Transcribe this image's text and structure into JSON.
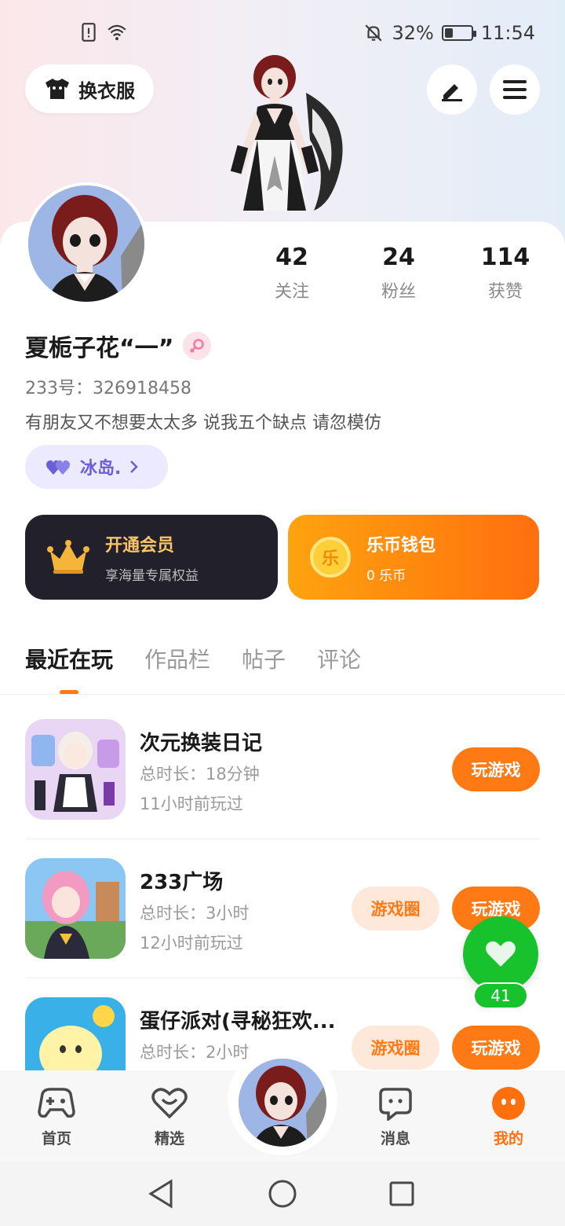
{
  "status_bar": {
    "battery": "32%",
    "time": "11:54",
    "battery_level": 0.32
  },
  "header": {
    "outfit_label": "换衣服"
  },
  "profile": {
    "stats": [
      {
        "value": "42",
        "label": "关注"
      },
      {
        "value": "24",
        "label": "粉丝"
      },
      {
        "value": "114",
        "label": "获赞"
      }
    ],
    "nickname": "夏栀子花“一”",
    "uid": "233号：326918458",
    "bio": "有朋友又不想要太太多  说我五个缺点  请忽模仿",
    "tag": "冰岛."
  },
  "cards": {
    "vip": {
      "title": "开通会员",
      "sub": "享海量专属权益"
    },
    "wallet": {
      "icon": "乐",
      "title": "乐币钱包",
      "sub": "0 乐币"
    }
  },
  "tabs": [
    {
      "label": "最近在玩"
    },
    {
      "label": "作品栏"
    },
    {
      "label": "帖子"
    },
    {
      "label": "评论"
    }
  ],
  "games": [
    {
      "name": "次元换装日记",
      "duration": "总时长：18分钟",
      "last_played": "11小时前玩过",
      "play": "玩游戏"
    },
    {
      "name": "233广场",
      "duration": "总时长：3小时",
      "last_played": "12小时前玩过",
      "circle": "游戏圈",
      "play": "玩游戏"
    },
    {
      "name": "蛋仔派对(寻秘狂欢...",
      "duration": "总时长：2小时",
      "circle": "游戏圈",
      "play": "玩游戏"
    }
  ],
  "float_like": {
    "count": "41"
  },
  "bottom_nav": [
    {
      "label": "首页"
    },
    {
      "label": "精选"
    },
    {
      "label": "消息"
    },
    {
      "label": "我的"
    }
  ],
  "colors": {
    "accent": "#ff7a14",
    "like_green": "#18c22c",
    "vip_dark": "#22202a",
    "tag_purple": "#6a5fd8"
  }
}
